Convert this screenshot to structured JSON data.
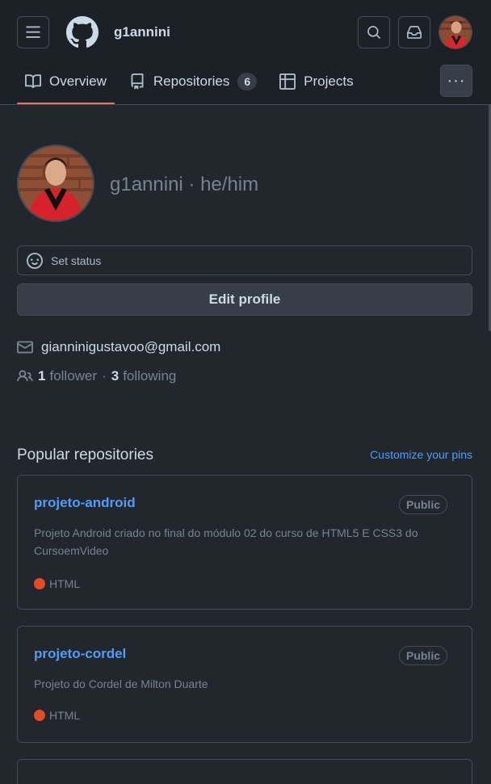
{
  "header": {
    "username": "g1annini",
    "menu_icon": "hamburger-icon",
    "logo_icon": "github-logo",
    "search_icon": "search-icon",
    "inbox_icon": "inbox-icon"
  },
  "tabs": [
    {
      "label": "Overview",
      "icon": "book-icon",
      "selected": true
    },
    {
      "label": "Repositories",
      "icon": "repo-icon",
      "count": "6"
    },
    {
      "label": "Projects",
      "icon": "table-icon"
    }
  ],
  "more_label": "···",
  "profile": {
    "name_line": "g1annini · he/him",
    "status_placeholder": "Set status",
    "edit_label": "Edit profile",
    "email": "gianninigustavoo@gmail.com",
    "followers_count": "1",
    "followers_label": "follower",
    "following_count": "3",
    "following_label": "following",
    "separator": "·"
  },
  "popular": {
    "title": "Popular repositories",
    "customize_label": "Customize your pins",
    "repos": [
      {
        "name": "projeto-android",
        "visibility": "Public",
        "description": "Projeto Android criado no final do módulo 02 do curso de HTML5 E CSS3 do CursoemVideo",
        "language": "HTML",
        "language_color": "#e34c26"
      },
      {
        "name": "projeto-cordel",
        "visibility": "Public",
        "description": "Projeto do Cordel de Milton Duarte",
        "language": "HTML",
        "language_color": "#e34c26"
      }
    ]
  },
  "colors": {
    "background": "#22272e",
    "header": "#1c2128",
    "accent": "#ec775c",
    "link": "#539bf5"
  }
}
